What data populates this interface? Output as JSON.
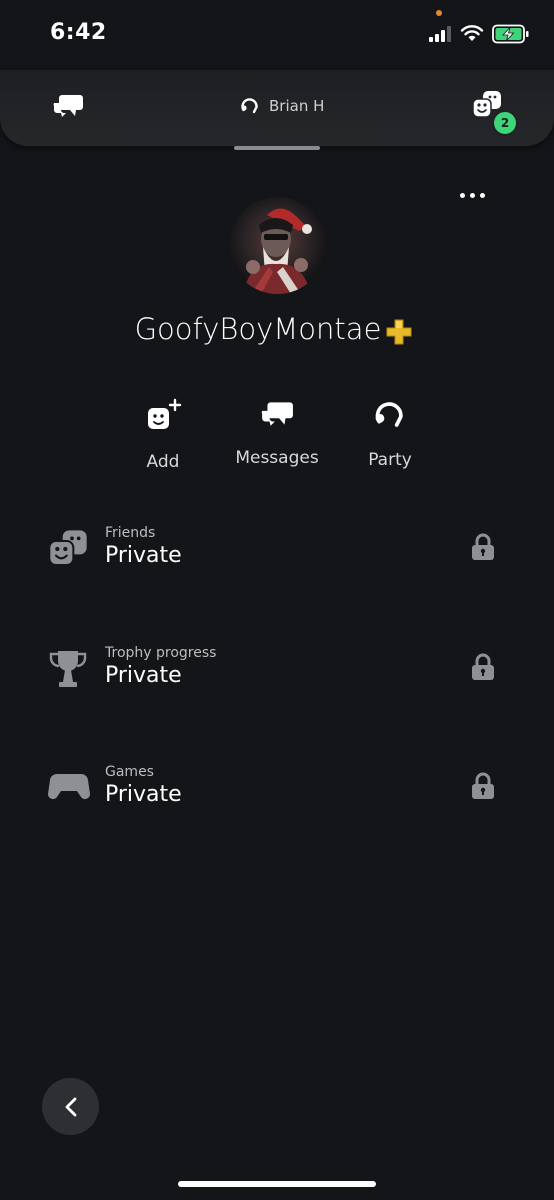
{
  "status": {
    "time": "6:42"
  },
  "nav": {
    "party_user": "Brian H",
    "friends_badge": "2"
  },
  "profile": {
    "username": "GoofyBoyMontae"
  },
  "actions": [
    {
      "label": "Add",
      "icon": "add-friend-icon"
    },
    {
      "label": "Messages",
      "icon": "messages-icon"
    },
    {
      "label": "Party",
      "icon": "party-icon"
    }
  ],
  "sections": [
    {
      "label": "Friends",
      "value": "Private",
      "icon": "friends-icon"
    },
    {
      "label": "Trophy progress",
      "value": "Private",
      "icon": "trophy-icon"
    },
    {
      "label": "Games",
      "value": "Private",
      "icon": "controller-icon"
    }
  ],
  "colors": {
    "background": "#141518",
    "badge": "#3fd37a",
    "ps_plus": "#e8b928"
  }
}
